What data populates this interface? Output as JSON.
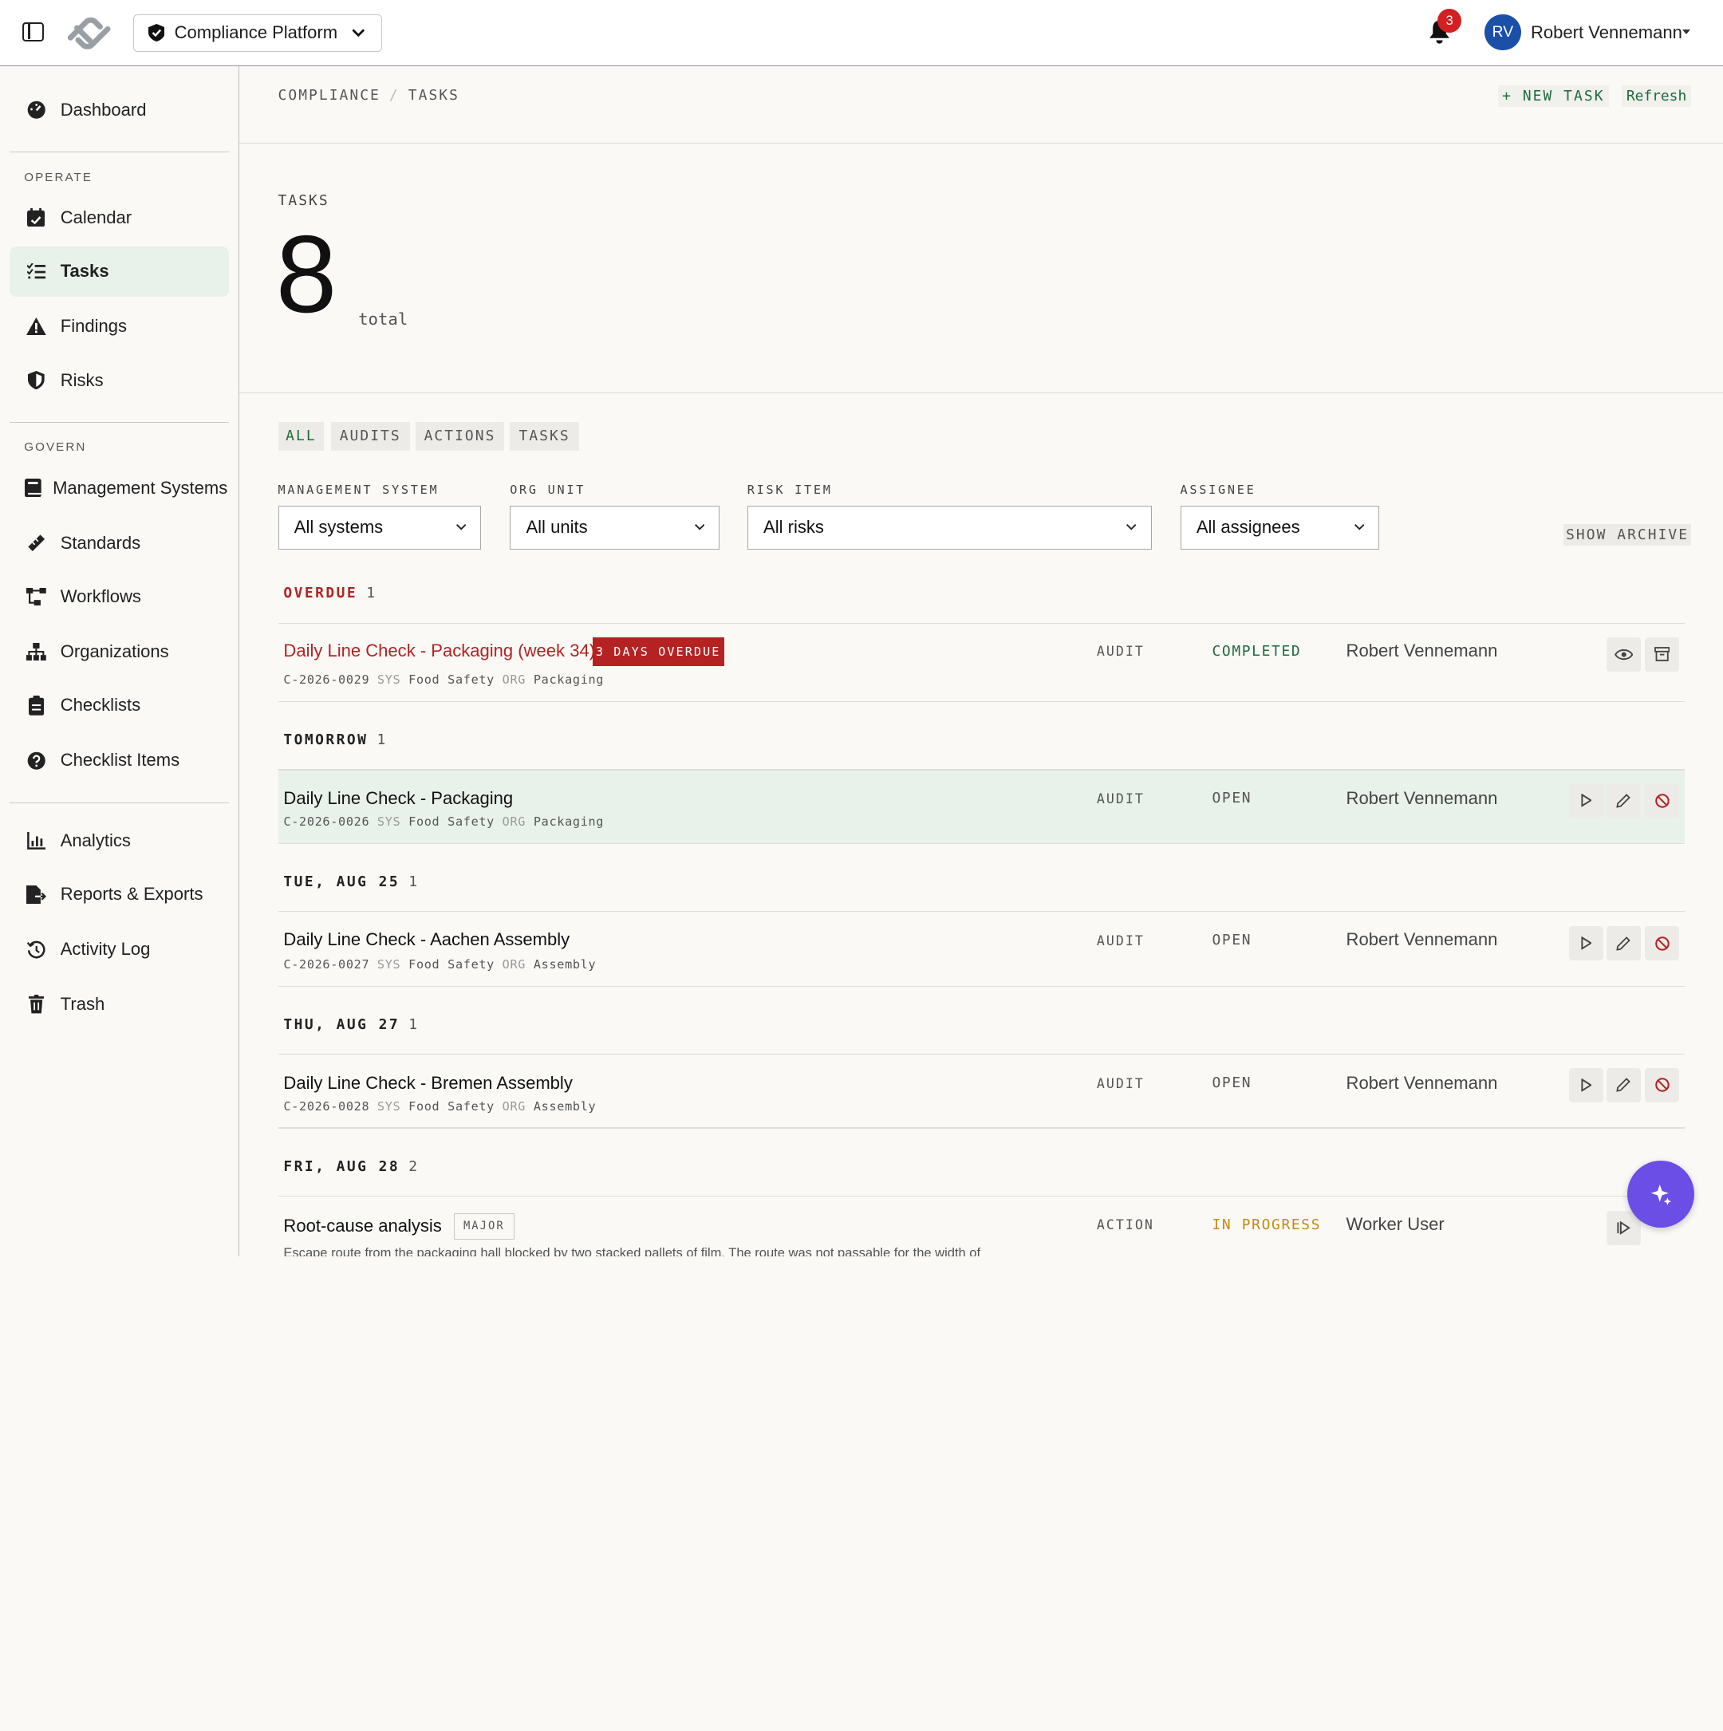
{
  "topbar": {
    "platform": "Compliance Platform",
    "notifications": "3",
    "user_initials": "RV",
    "user_name": "Robert Vennemann"
  },
  "sidebar": {
    "dashboard": "Dashboard",
    "operate_label": "OPERATE",
    "operate": [
      "Calendar",
      "Tasks",
      "Findings",
      "Risks"
    ],
    "govern_label": "GOVERN",
    "govern": [
      "Management Systems",
      "Standards",
      "Workflows",
      "Organizations",
      "Checklists",
      "Checklist Items"
    ],
    "other": [
      "Analytics",
      "Reports & Exports",
      "Activity Log",
      "Trash"
    ]
  },
  "header": {
    "breadcrumb": [
      "COMPLIANCE",
      "TASKS"
    ],
    "new_task": "+ NEW TASK",
    "refresh": "Refresh"
  },
  "summary": {
    "label": "TASKS",
    "count": "8",
    "unit": "total"
  },
  "filters": {
    "tabs": [
      "ALL",
      "AUDITS",
      "ACTIONS",
      "TASKS"
    ],
    "management_system": {
      "label": "MANAGEMENT SYSTEM",
      "value": "All systems"
    },
    "org_unit": {
      "label": "ORG UNIT",
      "value": "All units"
    },
    "risk_item": {
      "label": "RISK ITEM",
      "value": "All risks"
    },
    "assignee": {
      "label": "ASSIGNEE",
      "value": "All assignees"
    },
    "show_archive": "SHOW ARCHIVE"
  },
  "groups": [
    {
      "label": "OVERDUE",
      "count": "1"
    },
    {
      "label": "TOMORROW",
      "count": "1"
    },
    {
      "label": "TUE, AUG 25",
      "count": "1"
    },
    {
      "label": "THU, AUG 27",
      "count": "1"
    },
    {
      "label": "FRI, AUG 28",
      "count": "2"
    }
  ],
  "tasks": [
    {
      "title": "Daily Line Check - Packaging (week 34)",
      "badge": "3 DAYS OVERDUE",
      "id": "C-2026-0029",
      "sys_key": "SYS",
      "sys": "Food Safety",
      "org_key": "ORG",
      "org": "Packaging",
      "category": "AUDIT",
      "status": "COMPLETED",
      "assignee": "Robert Vennemann"
    },
    {
      "title": "Daily Line Check - Packaging",
      "id": "C-2026-0026",
      "sys_key": "SYS",
      "sys": "Food Safety",
      "org_key": "ORG",
      "org": "Packaging",
      "category": "AUDIT",
      "status": "OPEN",
      "assignee": "Robert Vennemann"
    },
    {
      "title": "Daily Line Check - Aachen Assembly",
      "id": "C-2026-0027",
      "sys_key": "SYS",
      "sys": "Food Safety",
      "org_key": "ORG",
      "org": "Assembly",
      "category": "AUDIT",
      "status": "OPEN",
      "assignee": "Robert Vennemann"
    },
    {
      "title": "Daily Line Check - Bremen Assembly",
      "id": "C-2026-0028",
      "sys_key": "SYS",
      "sys": "Food Safety",
      "org_key": "ORG",
      "org": "Assembly",
      "category": "AUDIT",
      "status": "OPEN",
      "assignee": "Robert Vennemann"
    },
    {
      "title": "Root-cause analysis",
      "severity": "MAJOR",
      "description": "Escape route from the packaging hall blocked by two stacked pallets of film. The route was not passable for the width of",
      "category": "ACTION",
      "status": "IN PROGRESS",
      "assignee": "Worker User"
    }
  ],
  "colors": {
    "accent": "#1e6b3d",
    "overdue": "#b52222",
    "active_bg": "#e8f2ea",
    "fab": "#6a4ee6",
    "in_progress": "#c48a10"
  },
  "icons": [
    "sidebar-toggle-icon",
    "logo-icon",
    "shield-icon",
    "chevron-down-icon",
    "bell-icon",
    "eye-icon",
    "archive-icon",
    "play-icon",
    "pencil-icon",
    "ban-icon",
    "sparkle-icon"
  ]
}
